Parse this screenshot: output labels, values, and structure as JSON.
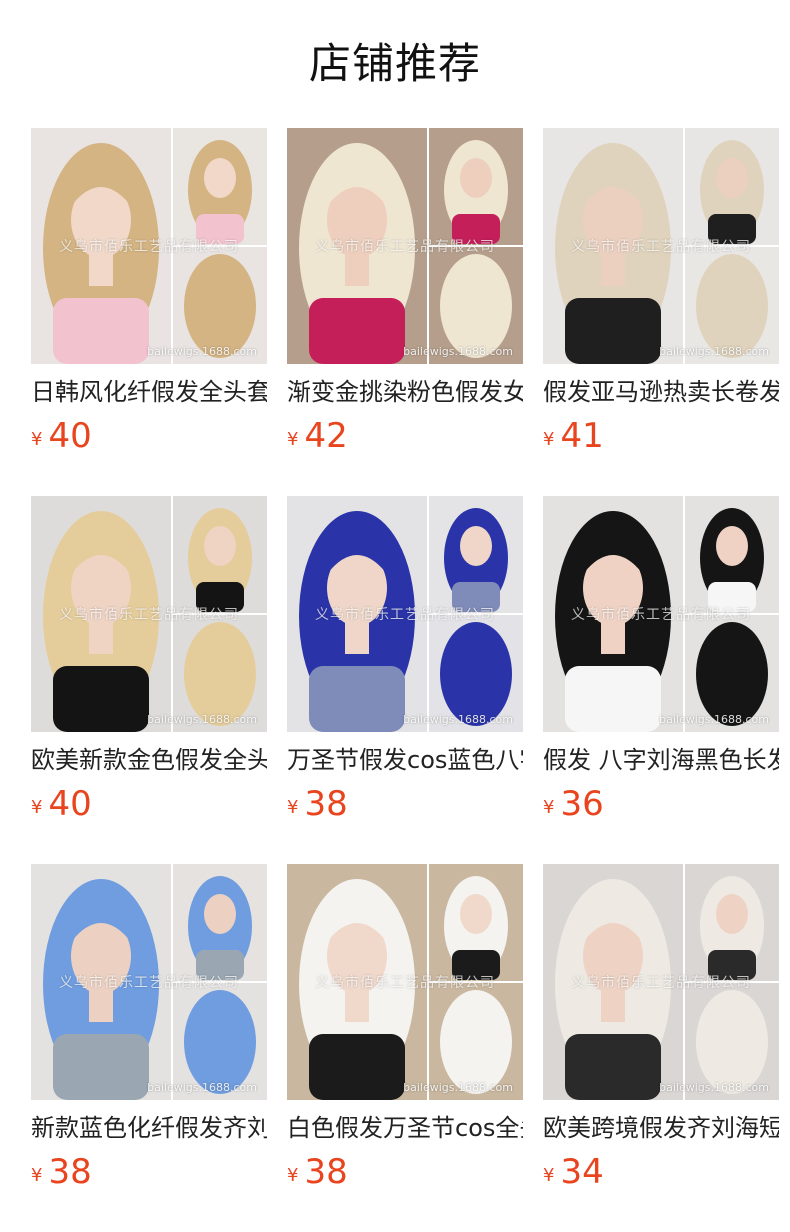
{
  "section_title": "店铺推荐",
  "watermark": "义乌市佰乐工艺品有限公司",
  "watermark_site": "bailewigs.1688.com",
  "currency": "¥",
  "price_color": "#e8451f",
  "products": [
    {
      "name": "日韩风化纤假发全头套",
      "price": "40",
      "colors": {
        "bg": "#e9e4e1",
        "hair": "#d4b483",
        "top": "#f2c3cf",
        "skin": "#f1d8c9"
      }
    },
    {
      "name": "渐变金挑染粉色假发女",
      "price": "42",
      "colors": {
        "bg": "#b59f8c",
        "hair": "#efe6d2",
        "top": "#c51f5a",
        "skin": "#eecfbd"
      }
    },
    {
      "name": "假发亚马逊热卖长卷发",
      "price": "41",
      "colors": {
        "bg": "#e8e6e4",
        "hair": "#dfd3bd",
        "top": "#1f1f1f",
        "skin": "#ecd0bf"
      }
    },
    {
      "name": "欧美新款金色假发全头套",
      "price": "40",
      "colors": {
        "bg": "#dedcda",
        "hair": "#e5cd9b",
        "top": "#141414",
        "skin": "#efd3c3"
      }
    },
    {
      "name": "万圣节假发cos蓝色八字",
      "price": "38",
      "colors": {
        "bg": "#e3e3e6",
        "hair": "#2a34a8",
        "top": "#7f8bb8",
        "skin": "#efd6c8"
      }
    },
    {
      "name": "假发 八字刘海黑色长发",
      "price": "36",
      "colors": {
        "bg": "#e3e2e0",
        "hair": "#151515",
        "top": "#f6f6f6",
        "skin": "#efd2c3"
      }
    },
    {
      "name": "新款蓝色化纤假发齐刘海",
      "price": "38",
      "colors": {
        "bg": "#e4e2e0",
        "hair": "#6f9ddf",
        "top": "#9aa7b3",
        "skin": "#ecd1c2"
      }
    },
    {
      "name": "白色假发万圣节cos全头套",
      "price": "38",
      "colors": {
        "bg": "#c9b79f",
        "hair": "#f4f3ef",
        "top": "#1b1b1b",
        "skin": "#f0d8cb"
      }
    },
    {
      "name": "欧美跨境假发齐刘海短发",
      "price": "34",
      "colors": {
        "bg": "#d9d6d3",
        "hair": "#eeeae3",
        "top": "#2a2a2a",
        "skin": "#eed3c4"
      }
    }
  ]
}
